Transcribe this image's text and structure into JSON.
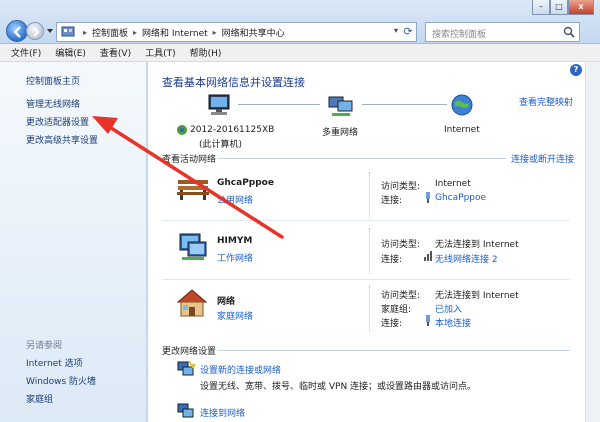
{
  "address": {
    "crumbs": [
      "控制面板",
      "网络和 Internet",
      "网络和共享中心"
    ],
    "search_placeholder": "搜索控制面板"
  },
  "window": {
    "minimize": "–",
    "maximize": "□",
    "close": "x"
  },
  "menu": [
    "文件(F)",
    "编辑(E)",
    "查看(V)",
    "工具(T)",
    "帮助(H)"
  ],
  "sidebar": {
    "items": [
      "控制面板主页",
      "管理无线网络",
      "更改适配器设置",
      "更改高级共享设置"
    ],
    "see_also_title": "另请参阅",
    "see_also": [
      "Internet 选项",
      "Windows 防火墙",
      "家庭组"
    ]
  },
  "main": {
    "title": "查看基本网络信息并设置连接",
    "full_map": "查看完整映射",
    "map_nodes": {
      "computer": "2012-20161125XB\n(此计算机)",
      "computer_line1": "2012-20161125XB",
      "computer_line2": "(此计算机)",
      "multi": "多重网络",
      "internet": "Internet"
    },
    "active_title": "查看活动网络",
    "connect_link": "连接或断开连接",
    "networks": [
      {
        "name": "GhcaPppoe",
        "type": "公用网络",
        "k1": "访问类型:",
        "v1": "Internet",
        "k2": "连接:",
        "v2": "GhcaPppoe"
      },
      {
        "name": "HIMYM",
        "type": "工作网络",
        "k1": "访问类型:",
        "v1": "无法连接到 Internet",
        "k2": "连接:",
        "v2": "无线网络连接 2"
      },
      {
        "name": "网络",
        "type": "家庭网络",
        "k1": "访问类型:",
        "v1": "无法连接到 Internet",
        "k2": "家庭组:",
        "v2": "已加入",
        "k3": "连接:",
        "v3": "本地连接"
      }
    ],
    "change_title": "更改网络设置",
    "tasks": [
      {
        "link": "设置新的连接或网络",
        "desc": "设置无线、宽带、拨号、临时或 VPN 连接；或设置路由器或访问点。"
      },
      {
        "link": "连接到网络"
      }
    ]
  },
  "colors": {
    "link": "#1b5fcc",
    "title": "#1b3d8f",
    "arrow": "#e8322a"
  }
}
